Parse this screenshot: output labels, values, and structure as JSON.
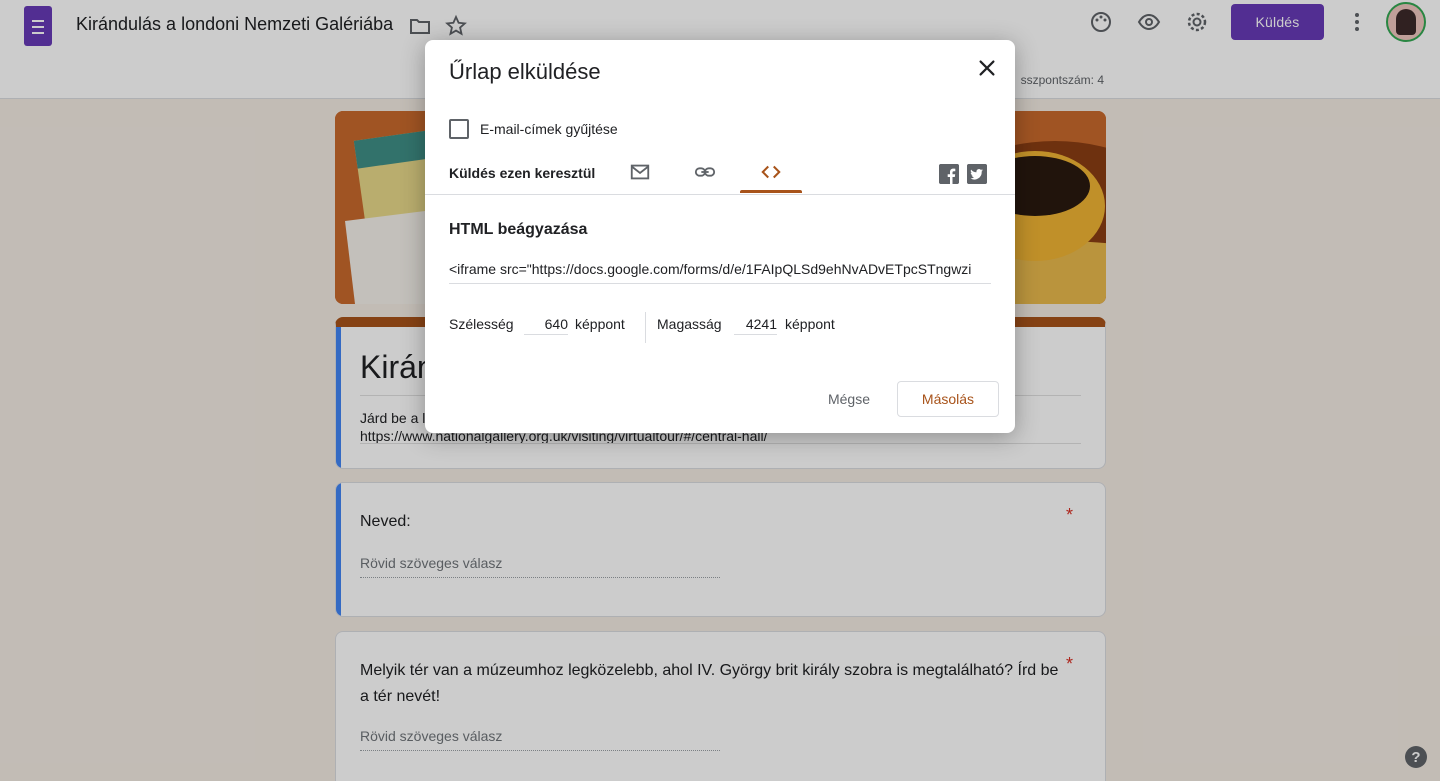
{
  "app": {
    "doc_title": "Kirándulás a londoni Nemzeti Galériába",
    "send_label": "Küldés",
    "points_text": "sszpontszám: 4"
  },
  "form": {
    "title_visible": "Kirán",
    "description": "Járd be a l\nhttps://www.nationalgallery.org.uk/visiting/virtualtour/#/central-hall/",
    "questions": [
      {
        "title": "Neved:",
        "placeholder": "Rövid szöveges válasz",
        "required": "*"
      },
      {
        "title": "Melyik tér van a múzeumhoz legközelebb, ahol IV. György brit király szobra is megtalálható? Írd be a tér nevét!",
        "placeholder": "Rövid szöveges válasz",
        "required": "*"
      }
    ]
  },
  "dialog": {
    "title": "Űrlap elküldése",
    "collect_emails_label": "E-mail-címek gyűjtése",
    "send_via_label": "Küldés ezen keresztül",
    "tabs": [
      "email-icon",
      "link-icon",
      "embed-icon"
    ],
    "active_tab": "embed-icon",
    "embed_title": "HTML beágyazása",
    "embed_code": "<iframe src=\"https://docs.google.com/forms/d/e/1FAIpQLSd9ehNvADvETpcSTngwzi",
    "width_label": "Szélesség",
    "width_value": "640",
    "width_unit": "képpont",
    "height_label": "Magasság",
    "height_value": "4241",
    "height_unit": "képpont",
    "cancel_label": "Mégse",
    "copy_label": "Másolás"
  },
  "colors": {
    "brand": "#673ab7",
    "accent": "#a8531a",
    "required": "#d93025"
  }
}
